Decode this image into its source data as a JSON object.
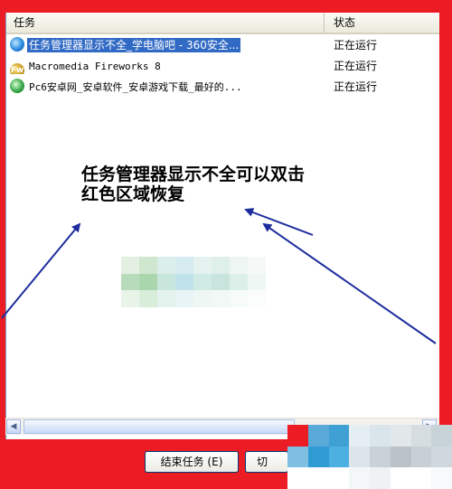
{
  "list": {
    "columns": {
      "task": "任务",
      "status": "状态"
    },
    "rows": [
      {
        "name": "任务管理器显示不全_学电脑吧 - 360安全...",
        "status": "正在运行",
        "icon": "ie-icon",
        "selected": true
      },
      {
        "name": "Macromedia Fireworks 8",
        "status": "正在运行",
        "icon": "fireworks-icon",
        "selected": false
      },
      {
        "name": "Pc6安卓网_安卓软件_安卓游戏下载_最好的...",
        "status": "正在运行",
        "icon": "ie-green-icon",
        "selected": false
      }
    ]
  },
  "annotation": {
    "line1": "任务管理器显示不全可以双击",
    "line2": "红色区域恢复"
  },
  "buttons": {
    "end_task": "结束任务 (E)",
    "switch": "切"
  },
  "colors": {
    "frame": "#ec1c24",
    "selection": "#316ac5",
    "arrow": "#1e2d9e"
  }
}
